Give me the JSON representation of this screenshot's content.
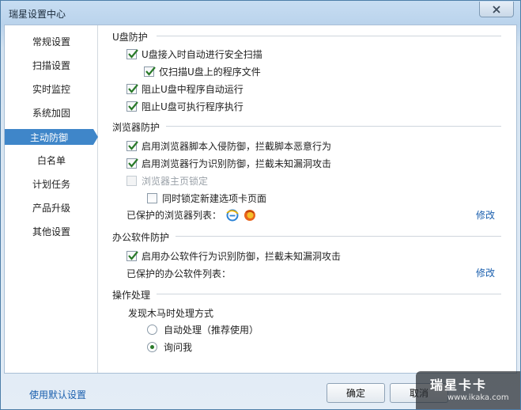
{
  "window": {
    "title": "瑞星设置中心"
  },
  "sidebar": {
    "items": [
      {
        "label": "常规设置"
      },
      {
        "label": "扫描设置"
      },
      {
        "label": "实时监控"
      },
      {
        "label": "系统加固"
      },
      {
        "label": "主动防御",
        "active": true
      },
      {
        "label": "白名单"
      },
      {
        "label": "计划任务"
      },
      {
        "label": "产品升级"
      },
      {
        "label": "其他设置"
      }
    ]
  },
  "usb": {
    "title": "U盘防护",
    "auto_scan": "U盘接入时自动进行安全扫描",
    "scan_only": "仅扫描U盘上的程序文件",
    "block_autorun": "阻止U盘中程序自动运行",
    "block_exec": "阻止U盘可执行程序执行"
  },
  "browser": {
    "title": "浏览器防护",
    "script_defense": "启用浏览器脚本入侵防御，拦截脚本恶意行为",
    "behavior_defense": "启用浏览器行为识别防御，拦截未知漏洞攻击",
    "homepage_lock": "浏览器主页锁定",
    "new_tab_lock": "同时锁定新建选项卡页面",
    "protected_list": "已保护的浏览器列表：",
    "modify": "修改",
    "icons": [
      "ie-icon",
      "firefox-icon"
    ]
  },
  "office": {
    "title": "办公软件防护",
    "behavior_defense": "启用办公软件行为识别防御，拦截未知漏洞攻击",
    "protected_list": "已保护的办公软件列表：",
    "modify": "修改"
  },
  "action": {
    "title": "操作处理",
    "trojan_label": "发现木马时处理方式",
    "auto": "自动处理（推荐使用）",
    "ask": "询问我",
    "selected": "ask"
  },
  "footer": {
    "default_link": "使用默认设置",
    "ok": "确定",
    "cancel": "取消"
  },
  "watermark": {
    "main": "瑞星卡卡",
    "sub": "www.ikaka.com"
  },
  "colors": {
    "accent": "#3f86c9",
    "link": "#1a5fae",
    "check": "#2a7a2a"
  }
}
